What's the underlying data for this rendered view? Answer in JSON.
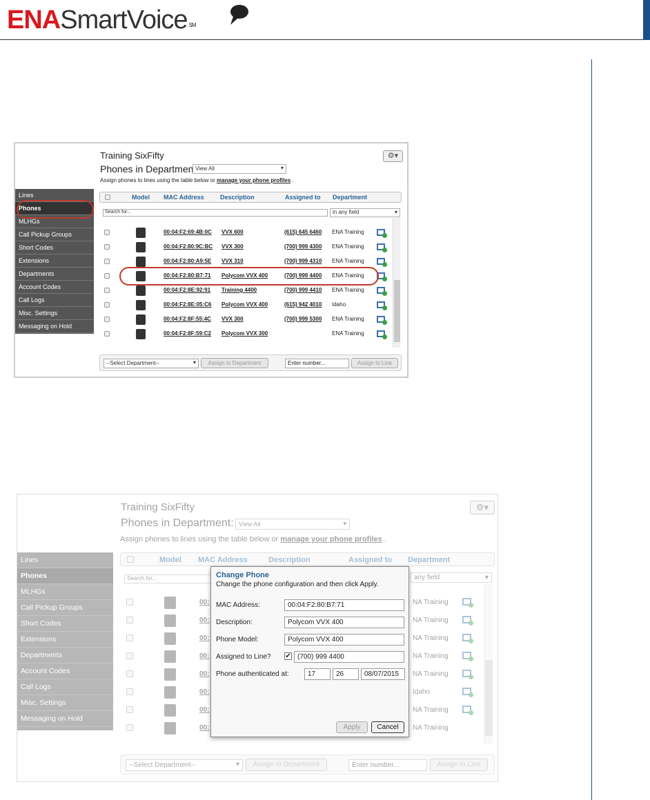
{
  "header": {
    "brand_a": "ENA",
    "brand_b": "SmartVoice",
    "brand_mark": "SM"
  },
  "app": {
    "org_title": "Training SixFifty",
    "phones_label": "Phones in Department:",
    "dept_select": "View All",
    "instruction_pre": "Assign phones to lines using the table below or",
    "instruction_link": "manage your phone profiles",
    "instruction_post": ".",
    "sidebar": [
      "Lines",
      "Phones",
      "MLHGs",
      "Call Pickup Groups",
      "Short Codes",
      "Extensions",
      "Departments",
      "Account Codes",
      "Call Logs",
      "Misc. Settings",
      "Messaging on Hold"
    ],
    "columns": {
      "model": "Model",
      "mac": "MAC Address",
      "description": "Description",
      "assigned": "Assigned to",
      "department": "Department"
    },
    "search_placeholder": "Search for...",
    "search_scope": "in any field",
    "rows": [
      {
        "mac": "00:04:F2:69:4B:0C",
        "desc": "VVX 600",
        "line": "(615) 645 6460",
        "dept": "ENA Training"
      },
      {
        "mac": "00:04:F2:80:9C:BC",
        "desc": "VVX 300",
        "line": "(700) 999 4300",
        "dept": "ENA Training"
      },
      {
        "mac": "00:04:F2:80:A9:5E",
        "desc": "VVX 310",
        "line": "(700) 999 4310",
        "dept": "ENA Training"
      },
      {
        "mac": "00:04:F2:80:B7:71",
        "desc": "Polycom VVX 400",
        "line": "(700) 999 4400",
        "dept": "ENA Training"
      },
      {
        "mac": "00:04:F2:8E:92:91",
        "desc": "Training 4400",
        "line": "(700) 999 4410",
        "dept": "ENA Training"
      },
      {
        "mac": "00:04:F2:8E:05:C6",
        "desc": "Polycom VVX 400",
        "line": "(615) 942 4010",
        "dept": "Idaho"
      },
      {
        "mac": "00:04:F2:8F:55:4C",
        "desc": "VVX 300",
        "line": "(700) 999 5300",
        "dept": "ENA Training"
      },
      {
        "mac": "00:04:F2:8F:59:C2",
        "desc": "Polycom VVX 300",
        "line": "",
        "dept": "ENA Training"
      }
    ],
    "footer": {
      "select_dept": "--Select Department--",
      "assign_dept": "Assign to Department",
      "number_placeholder": "Enter number...",
      "assign_line": "Assign to Line"
    },
    "screen2_rows": [
      {
        "mac": "00:",
        "dept": "NA Training"
      },
      {
        "mac": "00:",
        "dept": "NA Training"
      },
      {
        "mac": "00:",
        "dept": "NA Training"
      },
      {
        "mac": "00:",
        "dept": "NA Training"
      },
      {
        "mac": "00:",
        "dept": "NA Training"
      },
      {
        "mac": "00:",
        "dept": "Idaho"
      },
      {
        "mac": "00:",
        "dept": "NA Training"
      },
      {
        "mac": "00:",
        "dept": "NA Training"
      }
    ],
    "screen2_scope": "any field"
  },
  "dialog": {
    "title": "Change Phone",
    "subtitle": "Change the phone configuration and then click Apply.",
    "mac_label": "MAC Address:",
    "mac_value": "00:04:F2:80:B7:71",
    "desc_label": "Description:",
    "desc_value": "Polycom VVX 400",
    "model_label": "Phone Model:",
    "model_value": "Polycom VVX 400",
    "assigned_label": "Assigned to Line?",
    "assigned_value": "(700) 999 4400",
    "auth_label": "Phone authenticated at:",
    "auth_hour": "17",
    "auth_min": "26",
    "auth_date": "08/07/2015",
    "apply": "Apply",
    "cancel": "Cancel"
  }
}
